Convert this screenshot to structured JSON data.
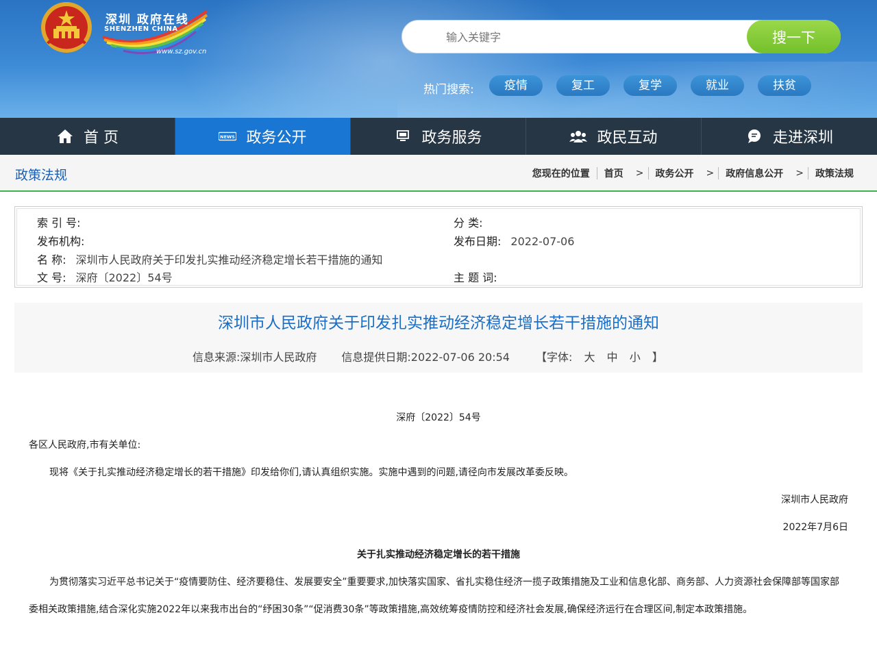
{
  "header": {
    "logo_cn": "深圳 政府在线",
    "logo_en": "SHENZHEN CHINA",
    "logo_url": "www.sz.gov.cn",
    "search_placeholder": "输入关键字",
    "search_button": "搜一下",
    "hot_label": "热门搜索:",
    "hot_tags": [
      "疫情",
      "复工",
      "复学",
      "就业",
      "扶贫"
    ]
  },
  "nav": {
    "items": [
      {
        "label": "首 页",
        "icon": "home-icon"
      },
      {
        "label": "政务公开",
        "icon": "news-icon"
      },
      {
        "label": "政务服务",
        "icon": "monitor-icon"
      },
      {
        "label": "政民互动",
        "icon": "people-icon"
      },
      {
        "label": "走进深圳",
        "icon": "chat-icon"
      }
    ],
    "active_index": 1
  },
  "crumb": {
    "section_title": "政策法规",
    "location_label": "您现在的位置",
    "path": [
      "首页",
      "政务公开",
      "政府信息公开",
      "政策法规"
    ],
    "arrow": ">"
  },
  "info": {
    "index_label": "索 引 号:",
    "index_value": "",
    "category_label": "分 类:",
    "category_value": "",
    "org_label": "发布机构:",
    "org_value": "",
    "date_label": "发布日期:",
    "date_value": "2022-07-06",
    "name_label": "名 称:",
    "name_value": "深圳市人民政府关于印发扎实推动经济稳定增长若干措施的通知",
    "docno_label": "文 号:",
    "docno_value": "深府〔2022〕54号",
    "subject_label": "主 题 词:",
    "subject_value": ""
  },
  "article": {
    "title": "深圳市人民政府关于印发扎实推动经济稳定增长若干措施的通知",
    "source": "信息来源:深圳市人民政府",
    "provide_date": "信息提供日期:2022-07-06 20:54",
    "font_label": "【字体:",
    "font_options": [
      "大",
      "中",
      "小"
    ],
    "font_close": "】"
  },
  "doc": {
    "number": "深府〔2022〕54号",
    "salutation": "各区人民政府,市有关单位:",
    "para1": "现将《关于扎实推动经济稳定增长的若干措施》印发给你们,请认真组织实施。实施中遇到的问题,请径向市发展改革委反映。",
    "signer": "深圳市人民政府",
    "sign_date": "2022年7月6日",
    "sub_title": "关于扎实推动经济稳定增长的若干措施",
    "para2": "为贯彻落实习近平总书记关于“疫情要防住、经济要稳住、发展要安全”重要要求,加快落实国家、省扎实稳住经济一揽子政策措施及工业和信息化部、商务部、人力资源社会保障部等国家部委相关政策措施,结合深化实施2022年以来我市出台的“纾困30条”“促消费30条”等政策措施,高效统筹疫情防控和经济社会发展,确保经济运行在合理区间,制定本政策措施。"
  }
}
